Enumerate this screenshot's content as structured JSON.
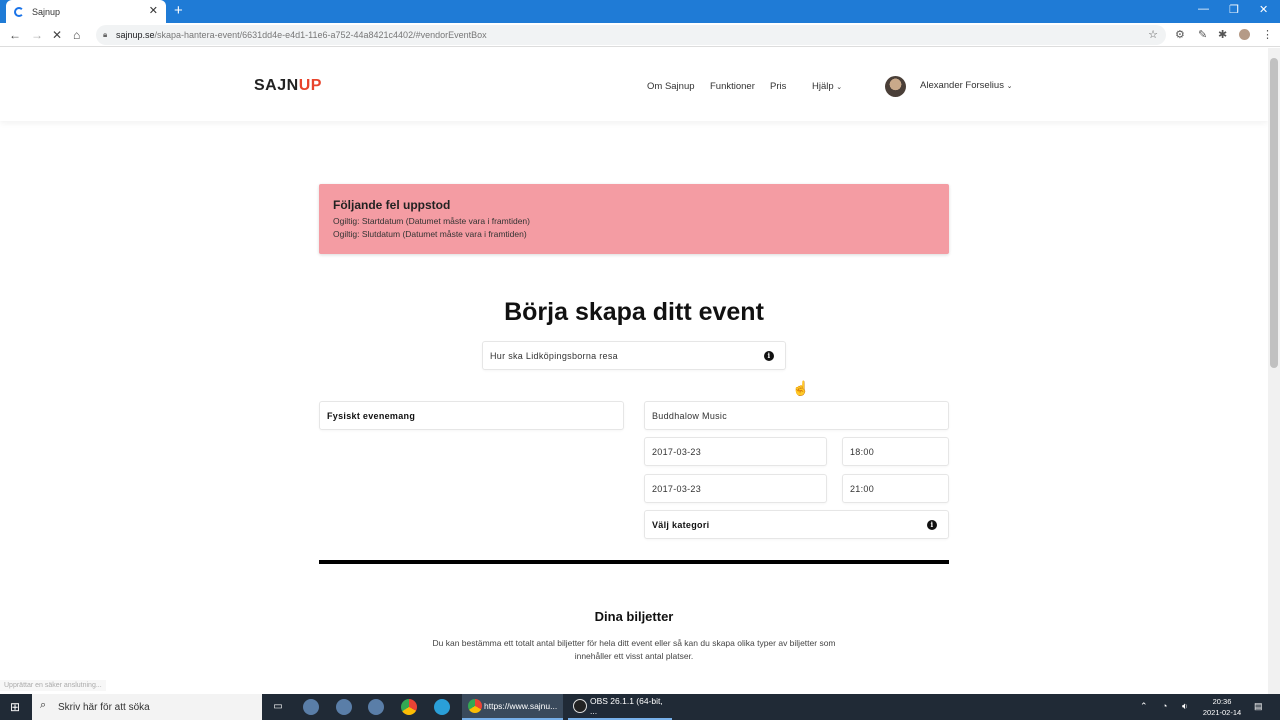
{
  "browser": {
    "tab_title": "Sajnup",
    "url_host": "sajnup.se",
    "url_path": "/skapa-hantera-event/6631dd4e-e4d1-11e6-a752-44a8421c4402/#vendorEventBox"
  },
  "site": {
    "logo_main": "SAJN",
    "logo_accent": "UP",
    "nav": [
      "Om Sajnup",
      "Funktioner",
      "Pris",
      "Hjälp"
    ],
    "user_name": "Alexander Forselius"
  },
  "alert": {
    "title": "Följande fel uppstod",
    "errors": [
      "Ogiltig: Startdatum (Datumet måste vara i framtiden)",
      "Ogiltig: Slutdatum (Datumet måste vara i framtiden)"
    ]
  },
  "form": {
    "heading": "Börja skapa ditt event",
    "event_name": "Hur ska Lidköpingsborna resa",
    "event_type": "Fysiskt evenemang",
    "venue": "Buddhalow Music",
    "start_date": "2017-03-23",
    "start_time": "18:00",
    "end_date": "2017-03-23",
    "end_time": "21:00",
    "category": "Välj kategori"
  },
  "tickets": {
    "title": "Dina biljetter",
    "description": "Du kan bestämma ett totalt antal biljetter för hela ditt event eller så kan du skapa olika typer av biljetter som innehåller ett visst antal platser."
  },
  "status_text": "Upprättar en säker anslutning...",
  "taskbar": {
    "search_placeholder": "Skriv här för att söka",
    "apps": [
      "https://www.sajnu...",
      "OBS 26.1.1 (64-bit, ..."
    ],
    "time": "20:36",
    "date": "2021-02-14"
  }
}
